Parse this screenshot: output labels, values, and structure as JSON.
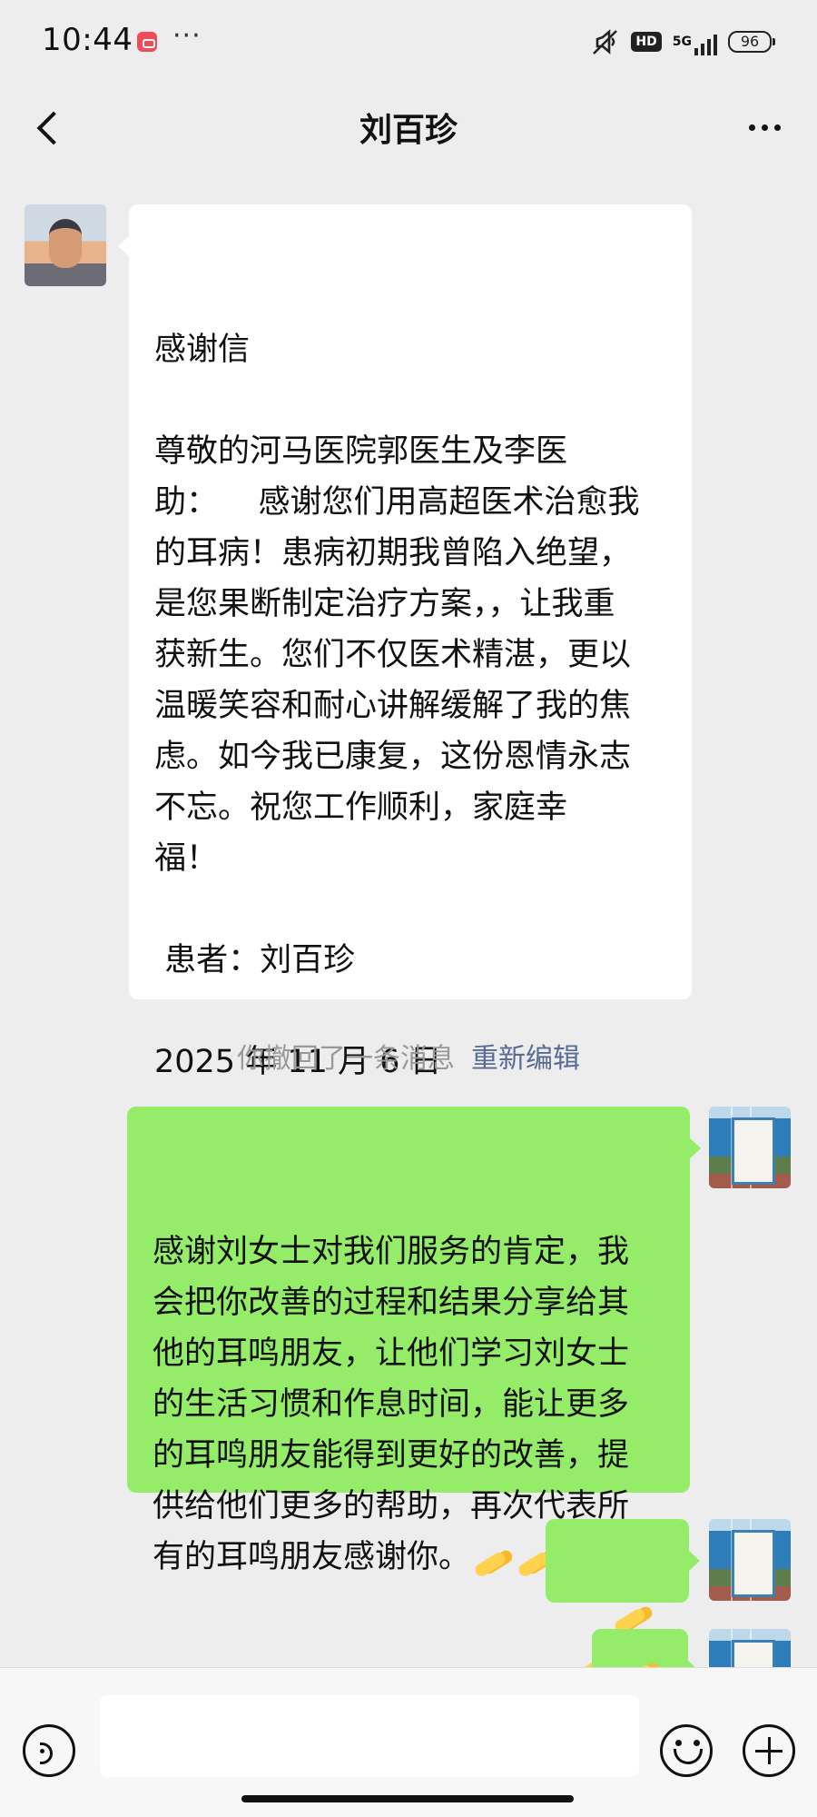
{
  "status_bar": {
    "time": "10:44",
    "more": "···",
    "hd": "HD",
    "network": "5G",
    "battery": "96",
    "icons": [
      "notification-icon",
      "mute-icon",
      "hd-icon",
      "signal-icon",
      "battery-icon"
    ]
  },
  "chat": {
    "title": "刘百珍",
    "messages": [
      {
        "side": "left",
        "avatar": "patient-avatar",
        "lines": [
          "感谢信",
          "",
          "尊敬的河马医院郭医生及李医",
          "助：    感谢您们用高超医术治愈我",
          "的耳病！患病初期我曾陷入绝望，",
          "是您果断制定治疗方案，，让我重",
          "获新生。您们不仅医术精湛，更以",
          "温暖笑容和耐心讲解缓解了我的焦",
          "虑。如今我已康复，这份恩情永志",
          "不忘。祝您工作顺利，家庭幸",
          "福！",
          "",
          " 患者：刘百珍",
          "",
          "2025 年 11 月 6 日"
        ]
      },
      {
        "side": "system",
        "text": "你撤回了一条消息",
        "action": "重新编辑"
      },
      {
        "side": "right",
        "avatar": "hospital-avatar",
        "lines": [
          "感谢刘女士对我们服务的肯定，我",
          "会把你改善的过程和结果分享给其",
          "他的耳鸣朋友，让他们学习刘女士",
          "的生活习惯和作息时间，能让更多",
          "的耳鸣朋友能得到更好的改善，提",
          "供给他们更多的帮助，再次代表所",
          "有的耳鸣朋友感谢你。"
        ]
      }
    ]
  },
  "input": {
    "placeholder": ""
  },
  "colors": {
    "background": "#ededed",
    "sent_bubble": "#95ec69",
    "received_bubble": "#ffffff",
    "link": "#576b95"
  }
}
